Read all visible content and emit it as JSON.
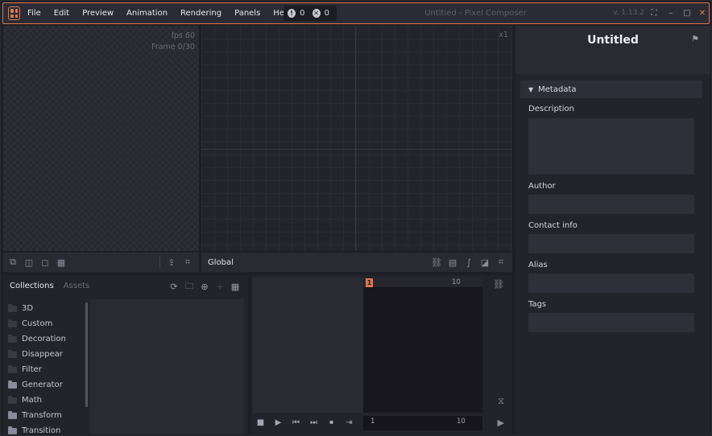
{
  "titlebar": {
    "menu": [
      "File",
      "Edit",
      "Preview",
      "Animation",
      "Rendering",
      "Panels",
      "Help"
    ],
    "warning_count": "0",
    "error_count": "0",
    "window_title": "Untitled - Pixel Composer",
    "version": "v. 1.13.2"
  },
  "preview": {
    "fps": "fps 60",
    "frame": "Frame 0/30"
  },
  "graph": {
    "zoom": "x1",
    "context_label": "Global"
  },
  "collections": {
    "tabs": [
      "Collections",
      "Assets"
    ],
    "folders": [
      {
        "name": "3D",
        "filled": false
      },
      {
        "name": "Custom",
        "filled": false
      },
      {
        "name": "Decoration",
        "filled": false
      },
      {
        "name": "Disappear",
        "filled": false
      },
      {
        "name": "Filter",
        "filled": false
      },
      {
        "name": "Generator",
        "filled": true
      },
      {
        "name": "Math",
        "filled": false
      },
      {
        "name": "Transform",
        "filled": true
      },
      {
        "name": "Transition",
        "filled": true
      }
    ]
  },
  "timeline": {
    "current_frame": "1",
    "ruler_end": "10",
    "range_start": "1",
    "range_end": "10"
  },
  "inspector": {
    "title": "Untitled",
    "section": "Metadata",
    "fields": {
      "description": "Description",
      "author": "Author",
      "contact": "Contact info",
      "alias": "Alias",
      "tags": "Tags"
    }
  },
  "colors": {
    "accent": "#e07a4a",
    "panel": "#23232b",
    "toolbar": "#2a2a33"
  }
}
